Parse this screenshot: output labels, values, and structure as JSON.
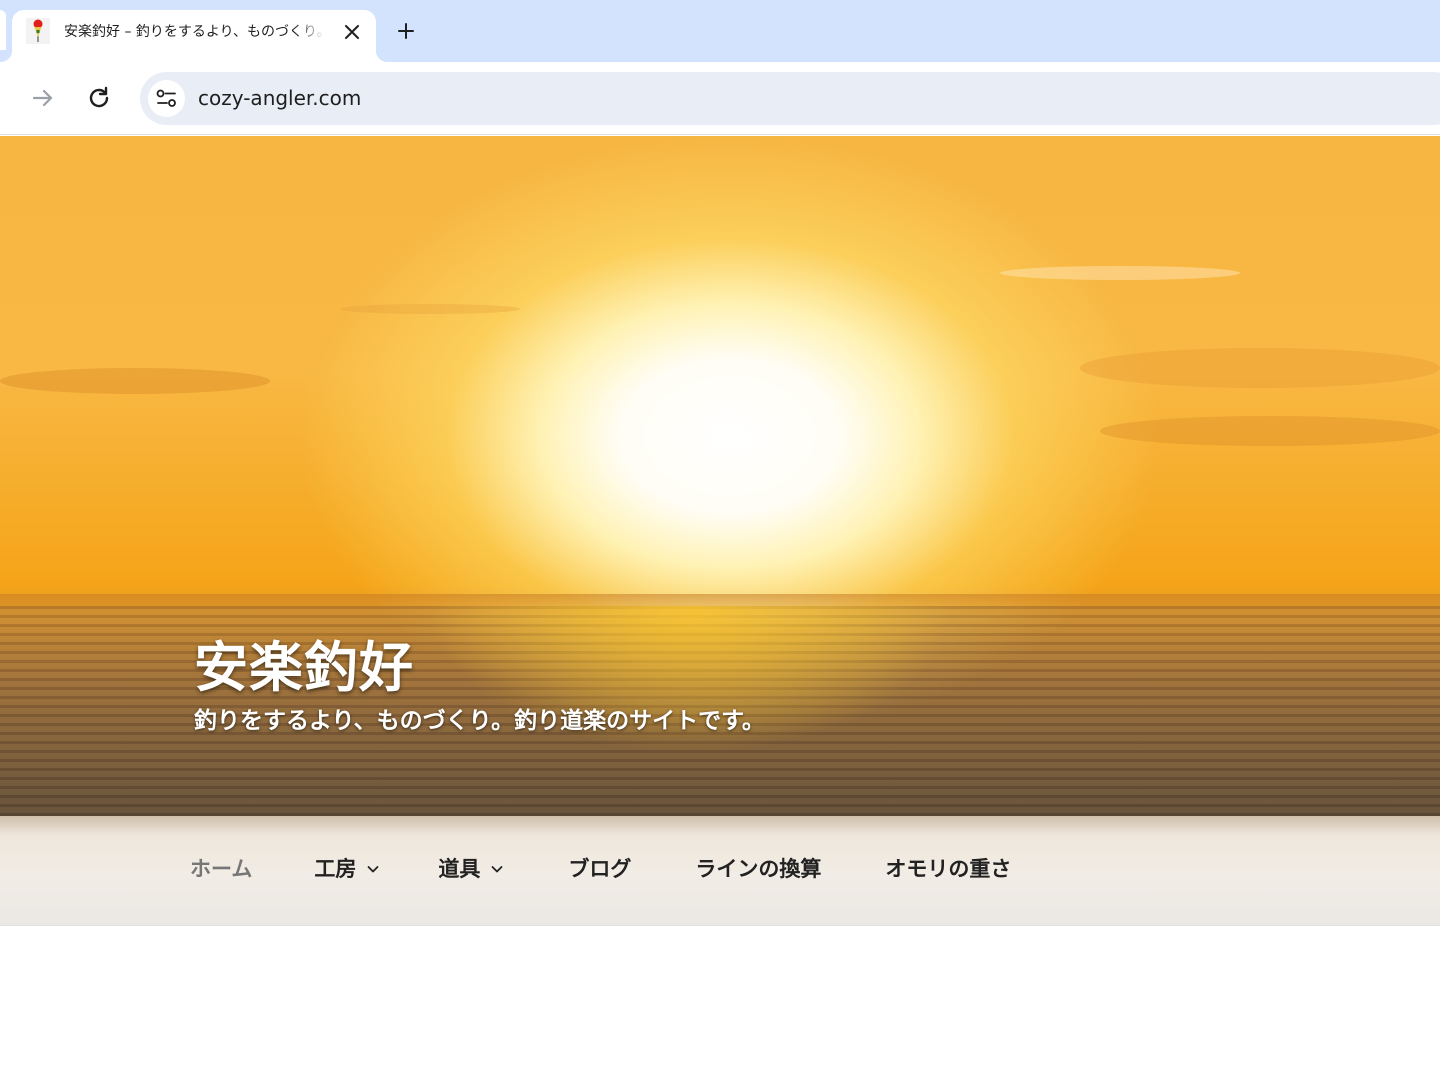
{
  "browser": {
    "tab": {
      "title": "安楽釣好 – 釣りをするより、ものづくり。釣り道楽のサイトです。",
      "favicon": "fishing-float-icon"
    },
    "address_bar": {
      "url": "cozy-angler.com"
    },
    "icons": {
      "close": "close-icon",
      "new_tab": "plus-icon",
      "forward": "arrow-right-icon",
      "reload": "reload-icon",
      "site_info": "tune-icon"
    },
    "colors": {
      "tabstrip": "#d3e3fd",
      "omnibox": "#e9eef6"
    }
  },
  "site": {
    "title": "安楽釣好",
    "tagline": "釣りをするより、ものづくり。釣り道楽のサイトです。"
  },
  "nav": {
    "items": [
      {
        "label": "ホーム",
        "current": true
      },
      {
        "label": "工房",
        "has_submenu": true
      },
      {
        "label": "道具",
        "has_submenu": true
      },
      {
        "label": "ブログ"
      },
      {
        "label": "ラインの換算"
      },
      {
        "label": "オモリの重さ"
      }
    ]
  }
}
